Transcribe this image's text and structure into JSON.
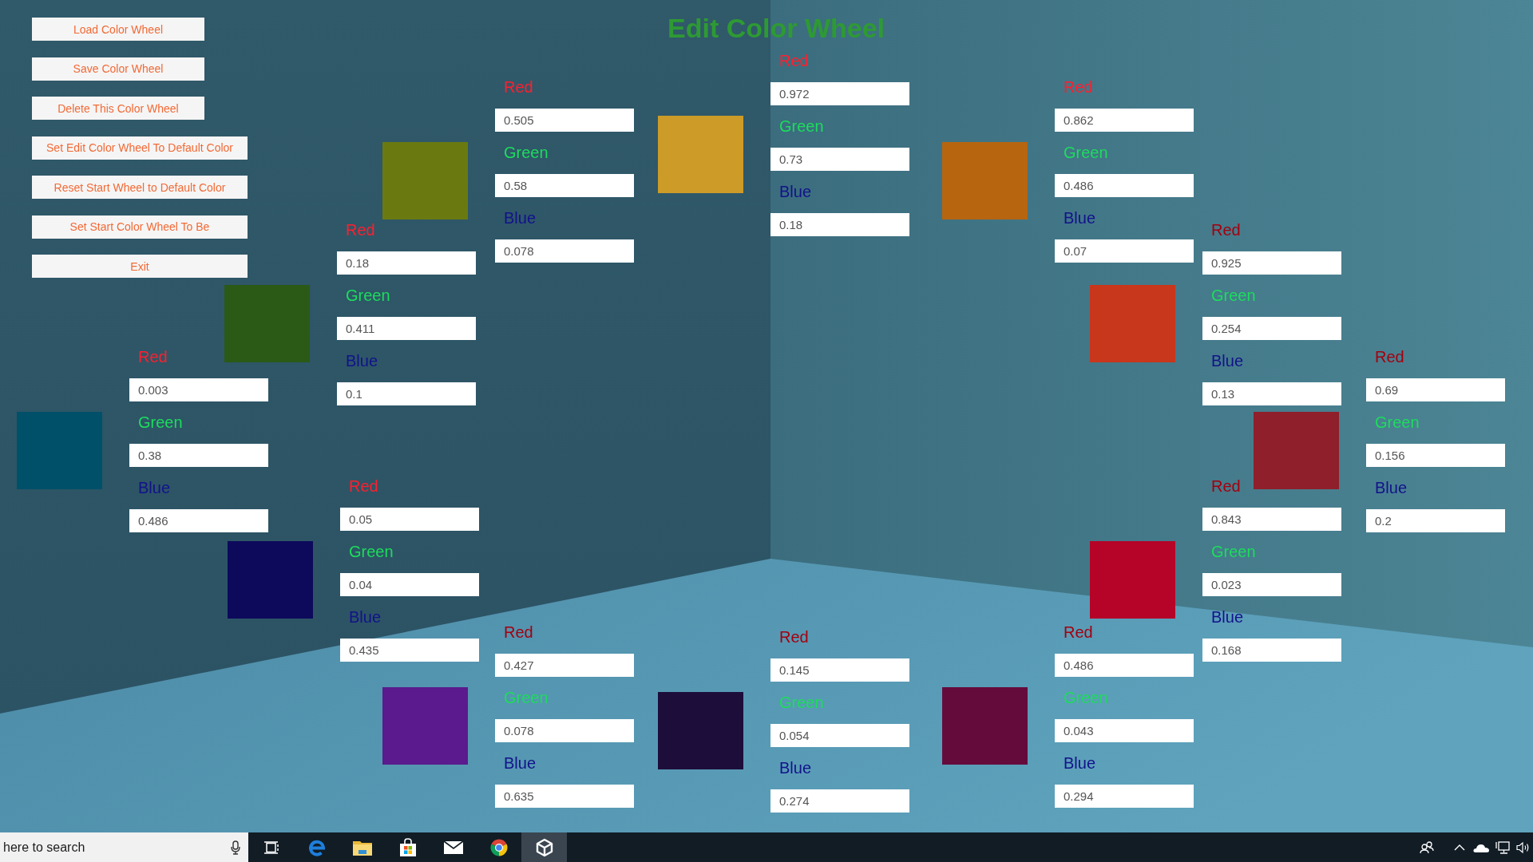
{
  "title": "Edit Color Wheel",
  "menu_buttons": [
    "Load Color Wheel",
    "Save Color Wheel",
    "Delete This Color Wheel",
    "Set Edit Color Wheel To Default Color",
    "Reset Start Wheel to Default Color",
    "Set Start Color Wheel To Be",
    "Exit"
  ],
  "color_editors": [
    {
      "color": "#6a7a10",
      "channels": [
        {
          "label": "Red",
          "value": "0.505"
        },
        {
          "label": "Green",
          "value": "0.58"
        },
        {
          "label": "Blue",
          "value": "0.078"
        }
      ]
    },
    {
      "color": "#cd9b28",
      "channels": [
        {
          "label": "Red",
          "value": "0.972"
        },
        {
          "label": "Green",
          "value": "0.73"
        },
        {
          "label": "Blue",
          "value": "0.18"
        }
      ]
    },
    {
      "color": "#b7650f",
      "channels": [
        {
          "label": "Red",
          "value": "0.862"
        },
        {
          "label": "Green",
          "value": "0.486"
        },
        {
          "label": "Blue",
          "value": "0.07"
        }
      ]
    },
    {
      "color": "#2a5a16",
      "channels": [
        {
          "label": "Red",
          "value": "0.18"
        },
        {
          "label": "Green",
          "value": "0.411"
        },
        {
          "label": "Blue",
          "value": "0.1"
        }
      ]
    },
    {
      "color": "#c8361b",
      "channels": [
        {
          "label": "Red",
          "value": "0.925"
        },
        {
          "label": "Green",
          "value": "0.254"
        },
        {
          "label": "Blue",
          "value": "0.13"
        }
      ]
    },
    {
      "color": "#00506a",
      "channels": [
        {
          "label": "Red",
          "value": "0.003"
        },
        {
          "label": "Green",
          "value": "0.38"
        },
        {
          "label": "Blue",
          "value": "0.486"
        }
      ]
    },
    {
      "color": "#8e1f2b",
      "channels": [
        {
          "label": "Red",
          "value": "0.69"
        },
        {
          "label": "Green",
          "value": "0.156"
        },
        {
          "label": "Blue",
          "value": "0.2"
        }
      ]
    },
    {
      "color": "#0d0a5c",
      "channels": [
        {
          "label": "Red",
          "value": "0.05"
        },
        {
          "label": "Green",
          "value": "0.04"
        },
        {
          "label": "Blue",
          "value": "0.435"
        }
      ]
    },
    {
      "color": "#b50428",
      "channels": [
        {
          "label": "Red",
          "value": "0.843"
        },
        {
          "label": "Green",
          "value": "0.023"
        },
        {
          "label": "Blue",
          "value": "0.168"
        }
      ]
    },
    {
      "color": "#5b1a8d",
      "channels": [
        {
          "label": "Red",
          "value": "0.427"
        },
        {
          "label": "Green",
          "value": "0.078"
        },
        {
          "label": "Blue",
          "value": "0.635"
        }
      ]
    },
    {
      "color": "#1d0d3a",
      "channels": [
        {
          "label": "Red",
          "value": "0.145"
        },
        {
          "label": "Green",
          "value": "0.054"
        },
        {
          "label": "Blue",
          "value": "0.274"
        }
      ]
    },
    {
      "color": "#650b3c",
      "channels": [
        {
          "label": "Red",
          "value": "0.486"
        },
        {
          "label": "Green",
          "value": "0.043"
        },
        {
          "label": "Blue",
          "value": "0.294"
        }
      ]
    }
  ],
  "taskbar": {
    "search": {
      "placeholder": "here to search"
    },
    "apps": [
      {
        "kind": "task-view",
        "selected": false
      },
      {
        "kind": "browser-e",
        "selected": false
      },
      {
        "kind": "folder",
        "selected": false
      },
      {
        "kind": "store",
        "selected": false
      },
      {
        "kind": "mail",
        "selected": false
      },
      {
        "kind": "browser-ring",
        "selected": false
      },
      {
        "kind": "cube-logo",
        "selected": true
      }
    ]
  }
}
